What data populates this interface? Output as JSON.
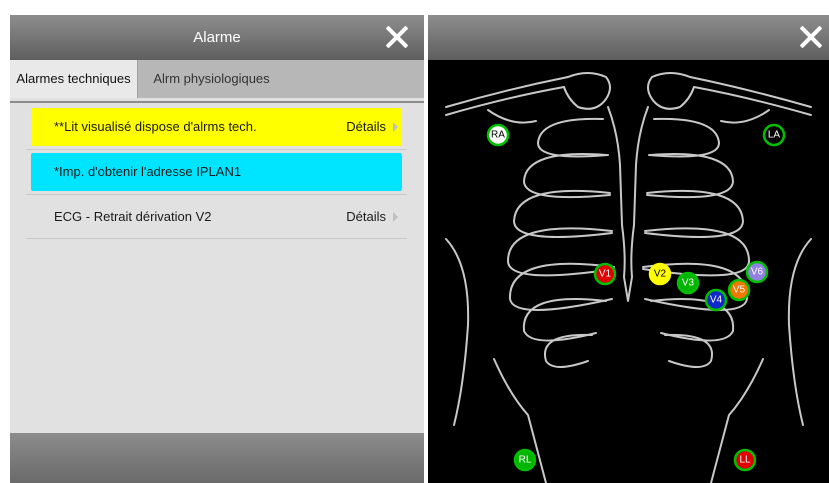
{
  "alarm_panel": {
    "title": "Alarme",
    "tabs": [
      {
        "label": "Alarmes techniques",
        "active": true
      },
      {
        "label": "Alrm physiologiques",
        "active": false
      }
    ],
    "alarms": [
      {
        "text": "**Lit visualisé dispose d'alrms tech.",
        "details": "Détails",
        "color": "#ffff00"
      },
      {
        "text": "*Imp. d'obtenir l'adresse IPLAN1",
        "details": "",
        "color": "#00e5ff"
      },
      {
        "text": "ECG - Retrait dérivation V2",
        "details": "Détails",
        "color": ""
      }
    ]
  },
  "ecg_panel": {
    "electrodes": [
      {
        "label": "RA",
        "fill": "#ffffff",
        "ring": "#00c000",
        "text": "#000000"
      },
      {
        "label": "LA",
        "fill": "#000000",
        "ring": "#00c000",
        "text": "#ffffff"
      },
      {
        "label": "V1",
        "fill": "#e00000",
        "ring": "#00c000",
        "text": "#ffffff"
      },
      {
        "label": "V2",
        "fill": "#ffff00",
        "ring": "#ffff00",
        "text": "#000000"
      },
      {
        "label": "V3",
        "fill": "#00b400",
        "ring": "#00c000",
        "text": "#ffffff"
      },
      {
        "label": "V4",
        "fill": "#1028c8",
        "ring": "#00c000",
        "text": "#ffffff"
      },
      {
        "label": "V5",
        "fill": "#f07800",
        "ring": "#00c000",
        "text": "#ffffff"
      },
      {
        "label": "V6",
        "fill": "#9080e0",
        "ring": "#00c000",
        "text": "#ffffff"
      },
      {
        "label": "RL",
        "fill": "#00b400",
        "ring": "#00c000",
        "text": "#ffffff"
      },
      {
        "label": "LL",
        "fill": "#e00000",
        "ring": "#00c000",
        "text": "#ffffff"
      }
    ]
  }
}
